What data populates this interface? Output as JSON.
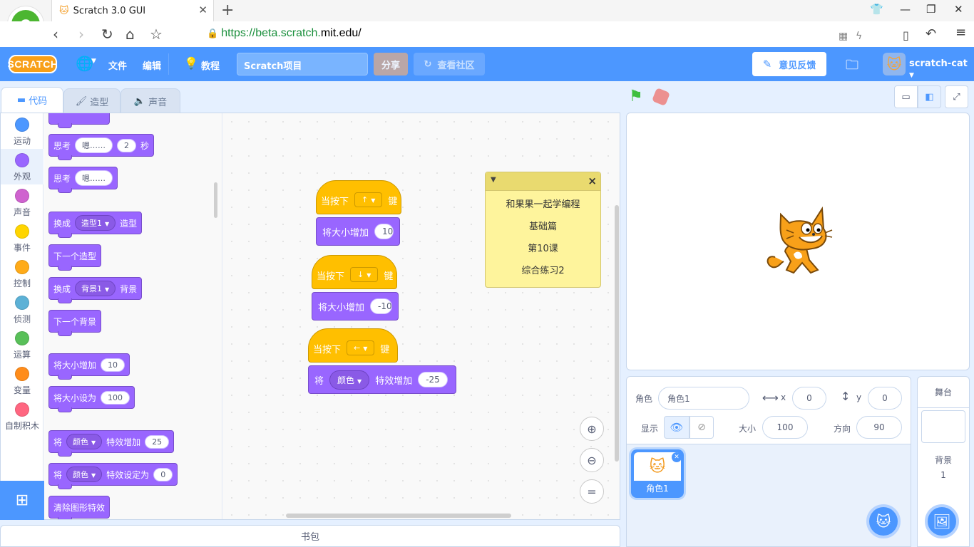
{
  "browser": {
    "tab_title": "Scratch 3.0 GUI",
    "url_scheme": "https://beta.scratch.",
    "url_domain": "mit.edu",
    "url_path": "/",
    "logo_letter": "e"
  },
  "menubar": {
    "logo_text": "SCRATCH",
    "file": "文件",
    "edit": "编辑",
    "tutorials": "教程",
    "project_title": "Scratch项目",
    "share": "分享",
    "see_community": "查看社区",
    "feedback": "意见反馈",
    "username": "scratch-cat"
  },
  "editor_tabs": {
    "code": "代码",
    "costumes": "造型",
    "sounds": "声音"
  },
  "categories": [
    {
      "label": "运动",
      "color": "#4c97ff"
    },
    {
      "label": "外观",
      "color": "#9966ff"
    },
    {
      "label": "声音",
      "color": "#cf63cf"
    },
    {
      "label": "事件",
      "color": "#ffd500"
    },
    {
      "label": "控制",
      "color": "#ffab19"
    },
    {
      "label": "侦测",
      "color": "#5cb1d6"
    },
    {
      "label": "运算",
      "color": "#59c059"
    },
    {
      "label": "变量",
      "color": "#ff8c1a"
    },
    {
      "label": "自制积木",
      "color": "#ff6680"
    }
  ],
  "palette": {
    "think_secs": {
      "label": "思考",
      "text": "嗯……",
      "secs": "2",
      "unit": "秒"
    },
    "think": {
      "label": "思考",
      "text": "嗯……"
    },
    "switch_costume": {
      "label": "换成",
      "value": "造型1",
      "suffix": "造型"
    },
    "next_costume": "下一个造型",
    "switch_backdrop": {
      "label": "换成",
      "value": "背景1",
      "suffix": "背景"
    },
    "next_backdrop": "下一个背景",
    "change_size": {
      "label": "将大小增加",
      "value": "10"
    },
    "set_size": {
      "label": "将大小设为",
      "value": "100"
    },
    "change_effect": {
      "label": "将",
      "effect": "颜色",
      "mid": "特效增加",
      "value": "25"
    },
    "set_effect": {
      "label": "将",
      "effect": "颜色",
      "mid": "特效设定为",
      "value": "0"
    },
    "clear_effects": "清除图形特效"
  },
  "scripts": [
    {
      "hat_label": "当按下",
      "key": "↑",
      "hat_suffix": "键",
      "action": "将大小增加",
      "value": "10"
    },
    {
      "hat_label": "当按下",
      "key": "↓",
      "hat_suffix": "键",
      "action": "将大小增加",
      "value": "-10"
    },
    {
      "hat_label": "当按下",
      "key": "←",
      "hat_suffix": "键",
      "action_prefix": "将",
      "effect": "颜色",
      "action": "特效增加",
      "value": "-25"
    }
  ],
  "note": {
    "lines": [
      "和果果一起学编程",
      "基础篇",
      "第10课",
      "综合练习2"
    ]
  },
  "backpack": "书包",
  "sprite_info": {
    "sprite_label": "角色",
    "sprite_name": "角色1",
    "x_label": "x",
    "x": "0",
    "y_label": "y",
    "y": "0",
    "show_label": "显示",
    "size_label": "大小",
    "size": "100",
    "direction_label": "方向",
    "direction": "90"
  },
  "sprites": [
    {
      "name": "角色1"
    }
  ],
  "stage_panel": {
    "header": "舞台",
    "backdrops_label": "背景",
    "backdrops_count": "1"
  },
  "colors": {
    "menubar": "#4c97ff",
    "looks": "#9966ff",
    "events": "#ffbf00",
    "note": "#fef49c"
  }
}
